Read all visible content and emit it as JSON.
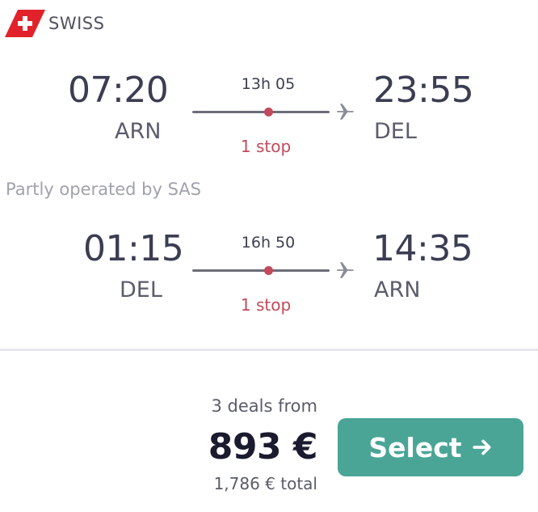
{
  "airline": {
    "name": "SWISS",
    "logo_color": "#e2222a"
  },
  "outbound": {
    "depart_time": "07:20",
    "depart_code": "ARN",
    "duration": "13h 05",
    "stops": "1 stop",
    "arrive_time": "23:55",
    "arrive_code": "DEL"
  },
  "operated_note": "Partly operated by SAS",
  "inbound": {
    "depart_time": "01:15",
    "depart_code": "DEL",
    "duration": "16h 50",
    "stops": "1 stop",
    "arrive_time": "14:35",
    "arrive_code": "ARN"
  },
  "pricing": {
    "deals_text": "3 deals from",
    "price": "893 €",
    "total": "1,786 € total"
  },
  "select_button": {
    "label": "Select",
    "color": "#4aa596"
  },
  "colors": {
    "stop_accent": "#c24a5a",
    "text_dark": "#1a1b2e"
  }
}
